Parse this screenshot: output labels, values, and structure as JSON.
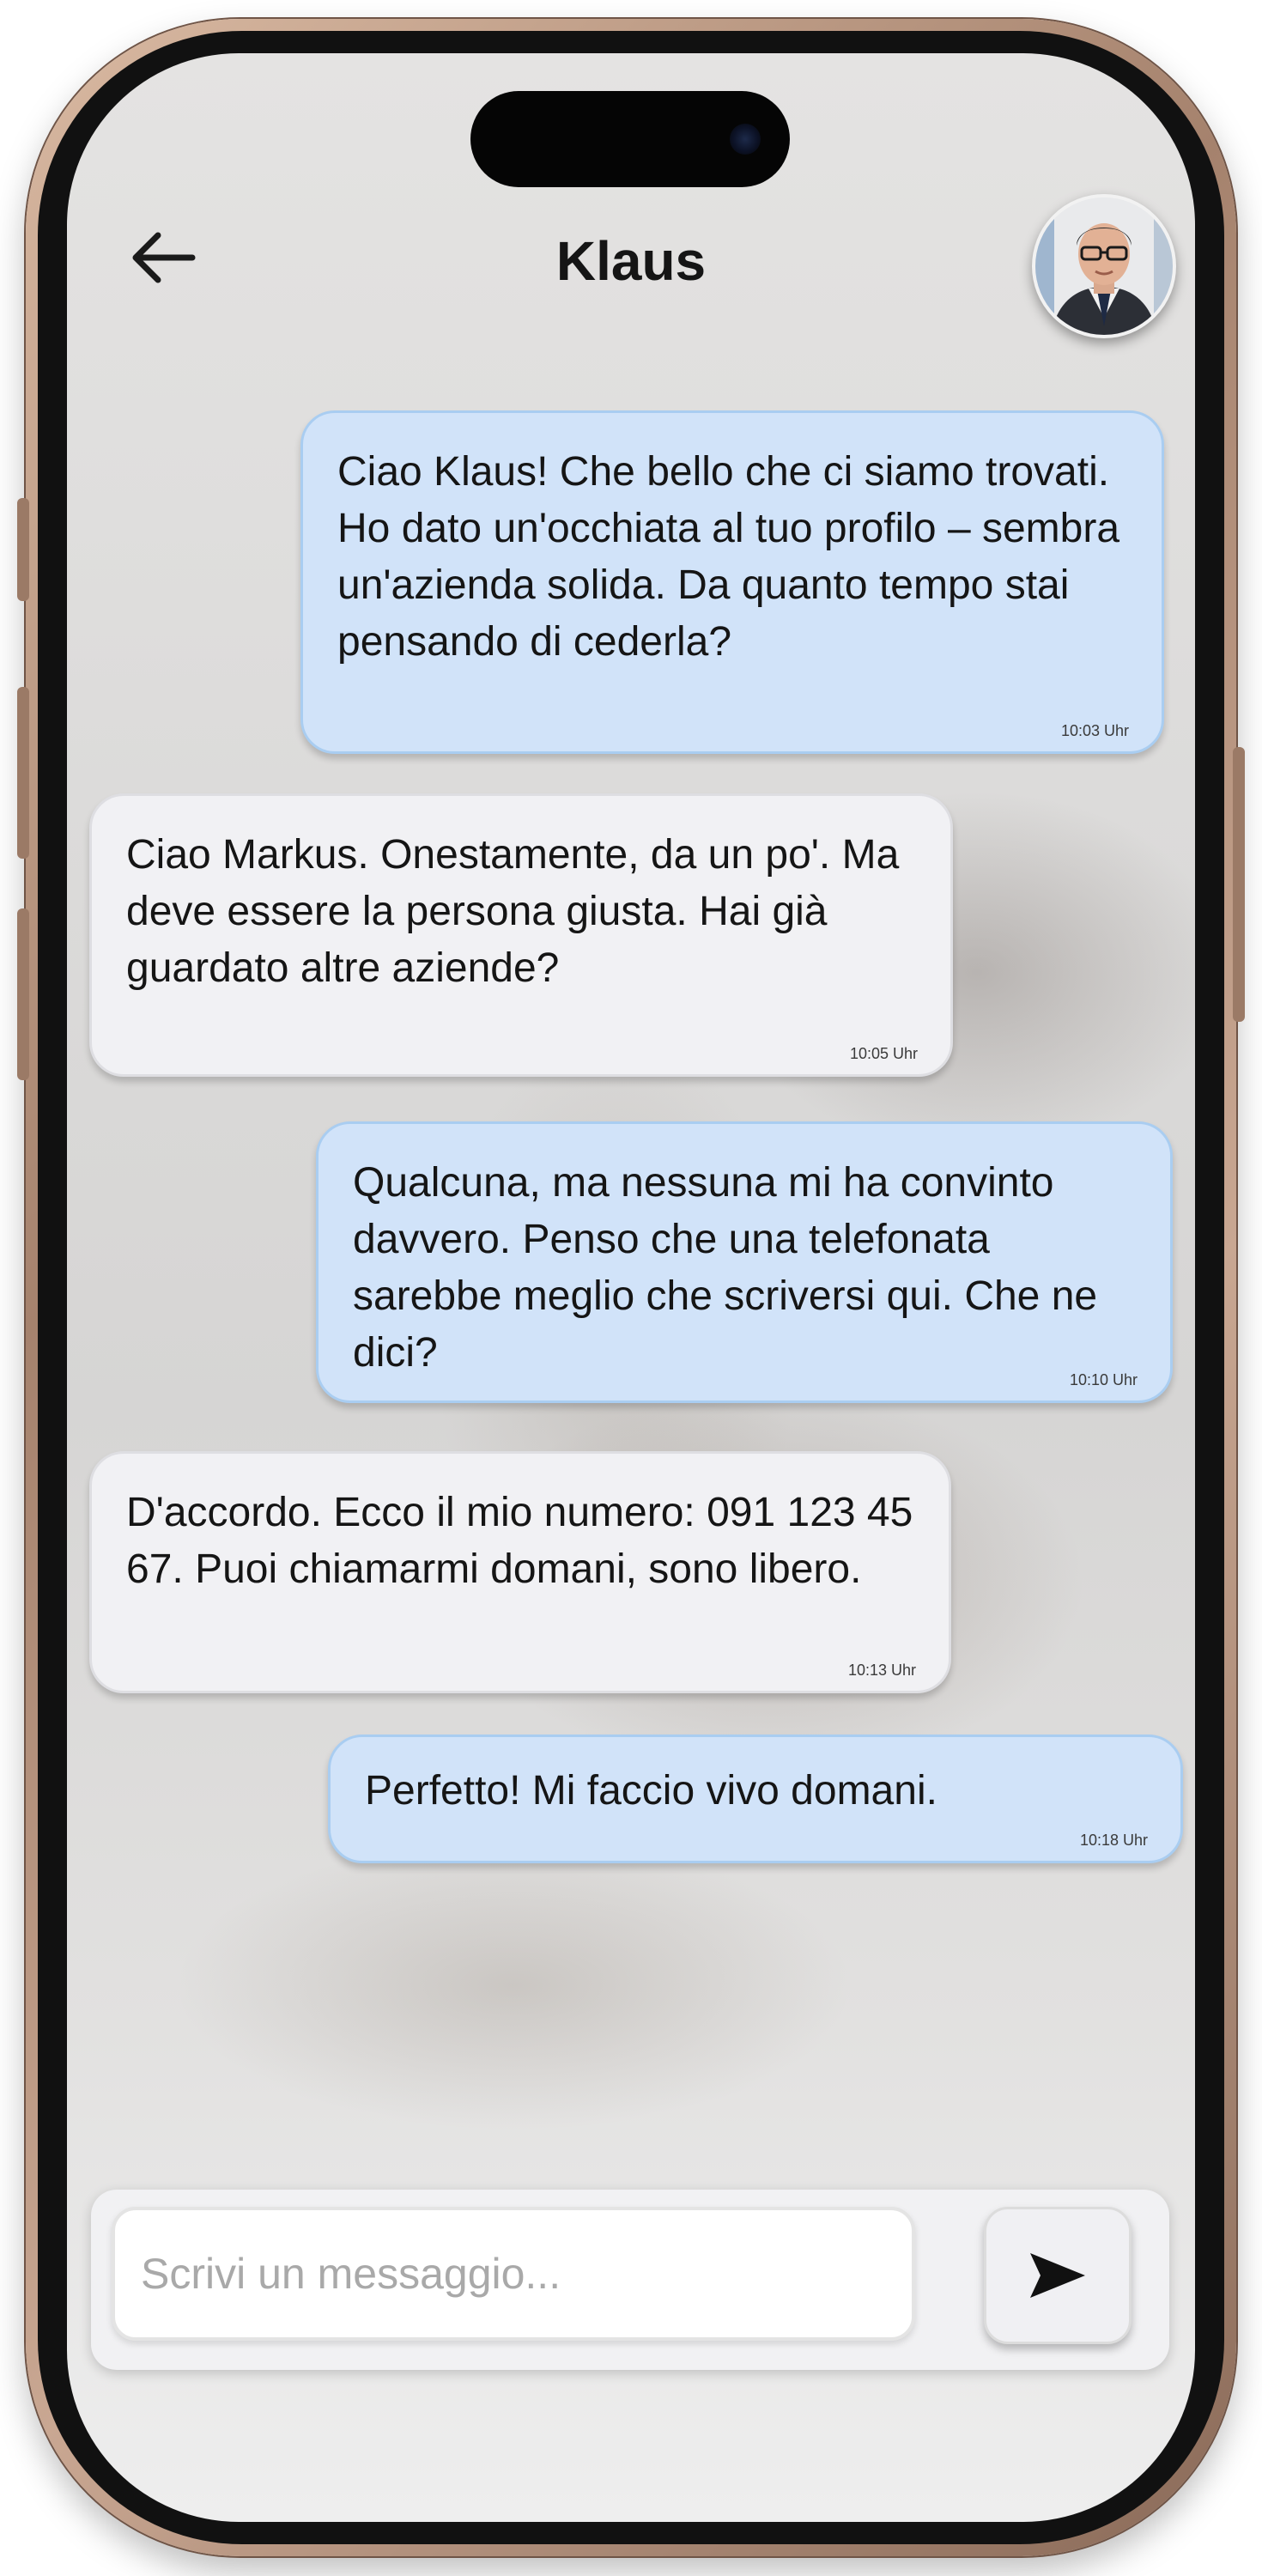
{
  "header": {
    "title": "Klaus",
    "back_icon": "arrow-left-icon",
    "avatar_icon": "contact-avatar"
  },
  "messages": [
    {
      "direction": "sent",
      "text": "Ciao Klaus! Che bello che ci siamo trovati. Ho dato un'occhiata al tuo profilo – sembra un'azienda solida. Da quanto tempo stai pensando di cederla?",
      "time": "10:03 Uhr"
    },
    {
      "direction": "received",
      "text": "Ciao Markus. Onestamente, da un po'. Ma deve essere la persona giusta. Hai già guardato altre aziende?",
      "time": "10:05 Uhr"
    },
    {
      "direction": "sent",
      "text": "Qualcuna, ma nessuna mi ha convinto davvero. Penso che una telefonata sarebbe meglio che scriversi qui. Che ne dici?",
      "time": "10:10 Uhr"
    },
    {
      "direction": "received",
      "text": "D'accordo. Ecco il mio numero: 091 123 45 67. Puoi chiamarmi domani, sono libero.",
      "time": "10:13 Uhr"
    },
    {
      "direction": "sent",
      "text": "Perfetto! Mi faccio vivo domani.",
      "time": "10:18 Uhr"
    }
  ],
  "composer": {
    "placeholder": "Scrivi un messaggio...",
    "value": "",
    "send_icon": "send-icon"
  },
  "colors": {
    "sent_bubble": "#d1e3f9",
    "sent_border": "#a9cdf1",
    "received_bubble": "#f1f1f4",
    "frame": "#b8937d"
  }
}
